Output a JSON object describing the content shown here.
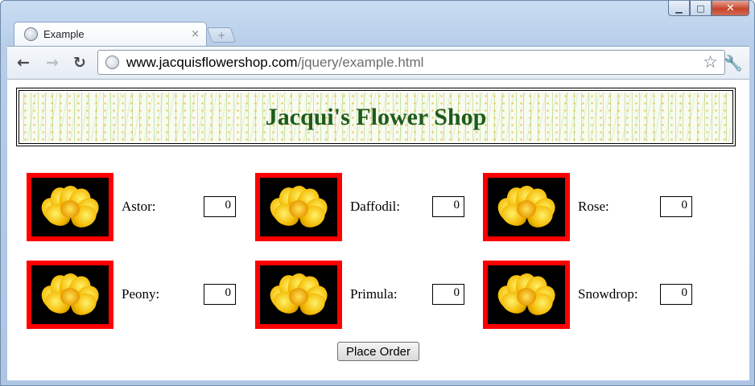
{
  "browser": {
    "tab_title": "Example",
    "tab_close": "×",
    "new_tab": "+",
    "url_host": "www.jacquisflowershop.com",
    "url_path": "/jquery/example.html",
    "back": "←",
    "forward": "→",
    "reload": "↻",
    "star": "☆",
    "wrench": "🔧",
    "window_buttons": {
      "minimize": "▁",
      "maximize": "□",
      "close": "✕"
    }
  },
  "page": {
    "title": "Jacqui's Flower Shop",
    "flowers": [
      {
        "name": "Astor:",
        "quantity": "0"
      },
      {
        "name": "Daffodil:",
        "quantity": "0"
      },
      {
        "name": "Rose:",
        "quantity": "0"
      },
      {
        "name": "Peony:",
        "quantity": "0"
      },
      {
        "name": "Primula:",
        "quantity": "0"
      },
      {
        "name": "Snowdrop:",
        "quantity": "0"
      }
    ],
    "order_button": "Place Order"
  },
  "colors": {
    "image_border": "#ff0000",
    "title_text": "#1d5b1d"
  }
}
